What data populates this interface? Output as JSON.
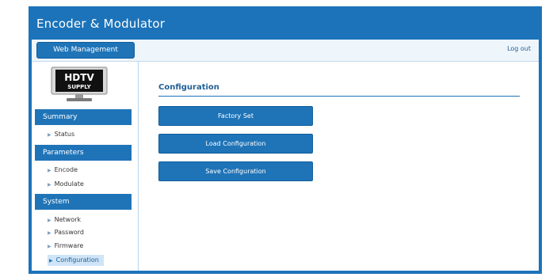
{
  "app": {
    "title": "Encoder & Modulator"
  },
  "topbar": {
    "tab_label": "Web Management",
    "logout_label": "Log out"
  },
  "logo": {
    "line1": "HDTV",
    "line2": "SUPPLY"
  },
  "sidebar": {
    "summary": {
      "label": "Summary",
      "items": [
        "Status"
      ]
    },
    "parameters": {
      "label": "Parameters",
      "items": [
        "Encode",
        "Modulate"
      ]
    },
    "system": {
      "label": "System",
      "items": [
        "Network",
        "Password",
        "Firmware",
        "Configuration"
      ],
      "active": "Configuration"
    }
  },
  "main": {
    "title": "Configuration",
    "buttons": [
      "Factory Set",
      "Load Configuration",
      "Save Configuration"
    ]
  },
  "colors": {
    "frame": "#1c73b9",
    "accent": "#1f74b8",
    "topbar": "#eef5fb"
  }
}
